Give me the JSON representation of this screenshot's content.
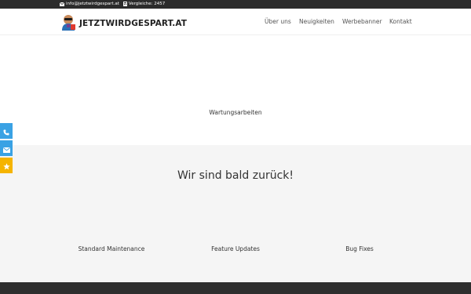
{
  "topbar": {
    "email": "info@jetztwirdgespart.at",
    "comparisons": "Vergleiche: 2457",
    "email_icon": "envelope-icon",
    "comparisons_icon": "calculator-icon"
  },
  "header": {
    "logo_text": "JETZTWIRDGESPART.AT",
    "nav": [
      {
        "label": "Über uns"
      },
      {
        "label": "Neuigkeiten"
      },
      {
        "label": "Werbebanner"
      },
      {
        "label": "Kontakt"
      }
    ]
  },
  "main": {
    "maintenance_text": "Wartungsarbeiten",
    "back_heading": "Wir sind bald zurück!",
    "features": [
      {
        "label": "Standard Maintenance"
      },
      {
        "label": "Feature Updates"
      },
      {
        "label": "Bug Fixes"
      }
    ]
  },
  "side_buttons": [
    {
      "icon": "phone-icon",
      "color": "#3aa2e4"
    },
    {
      "icon": "envelope-icon",
      "color": "#3aa2e4"
    },
    {
      "icon": "star-icon",
      "color": "#f5b400"
    }
  ],
  "colors": {
    "topbar_bg": "#2b2b2b",
    "footer_bg": "#2e2e2e",
    "gray_section": "#f5f5f5",
    "accent_blue": "#3aa2e4",
    "accent_yellow": "#f5b400"
  }
}
